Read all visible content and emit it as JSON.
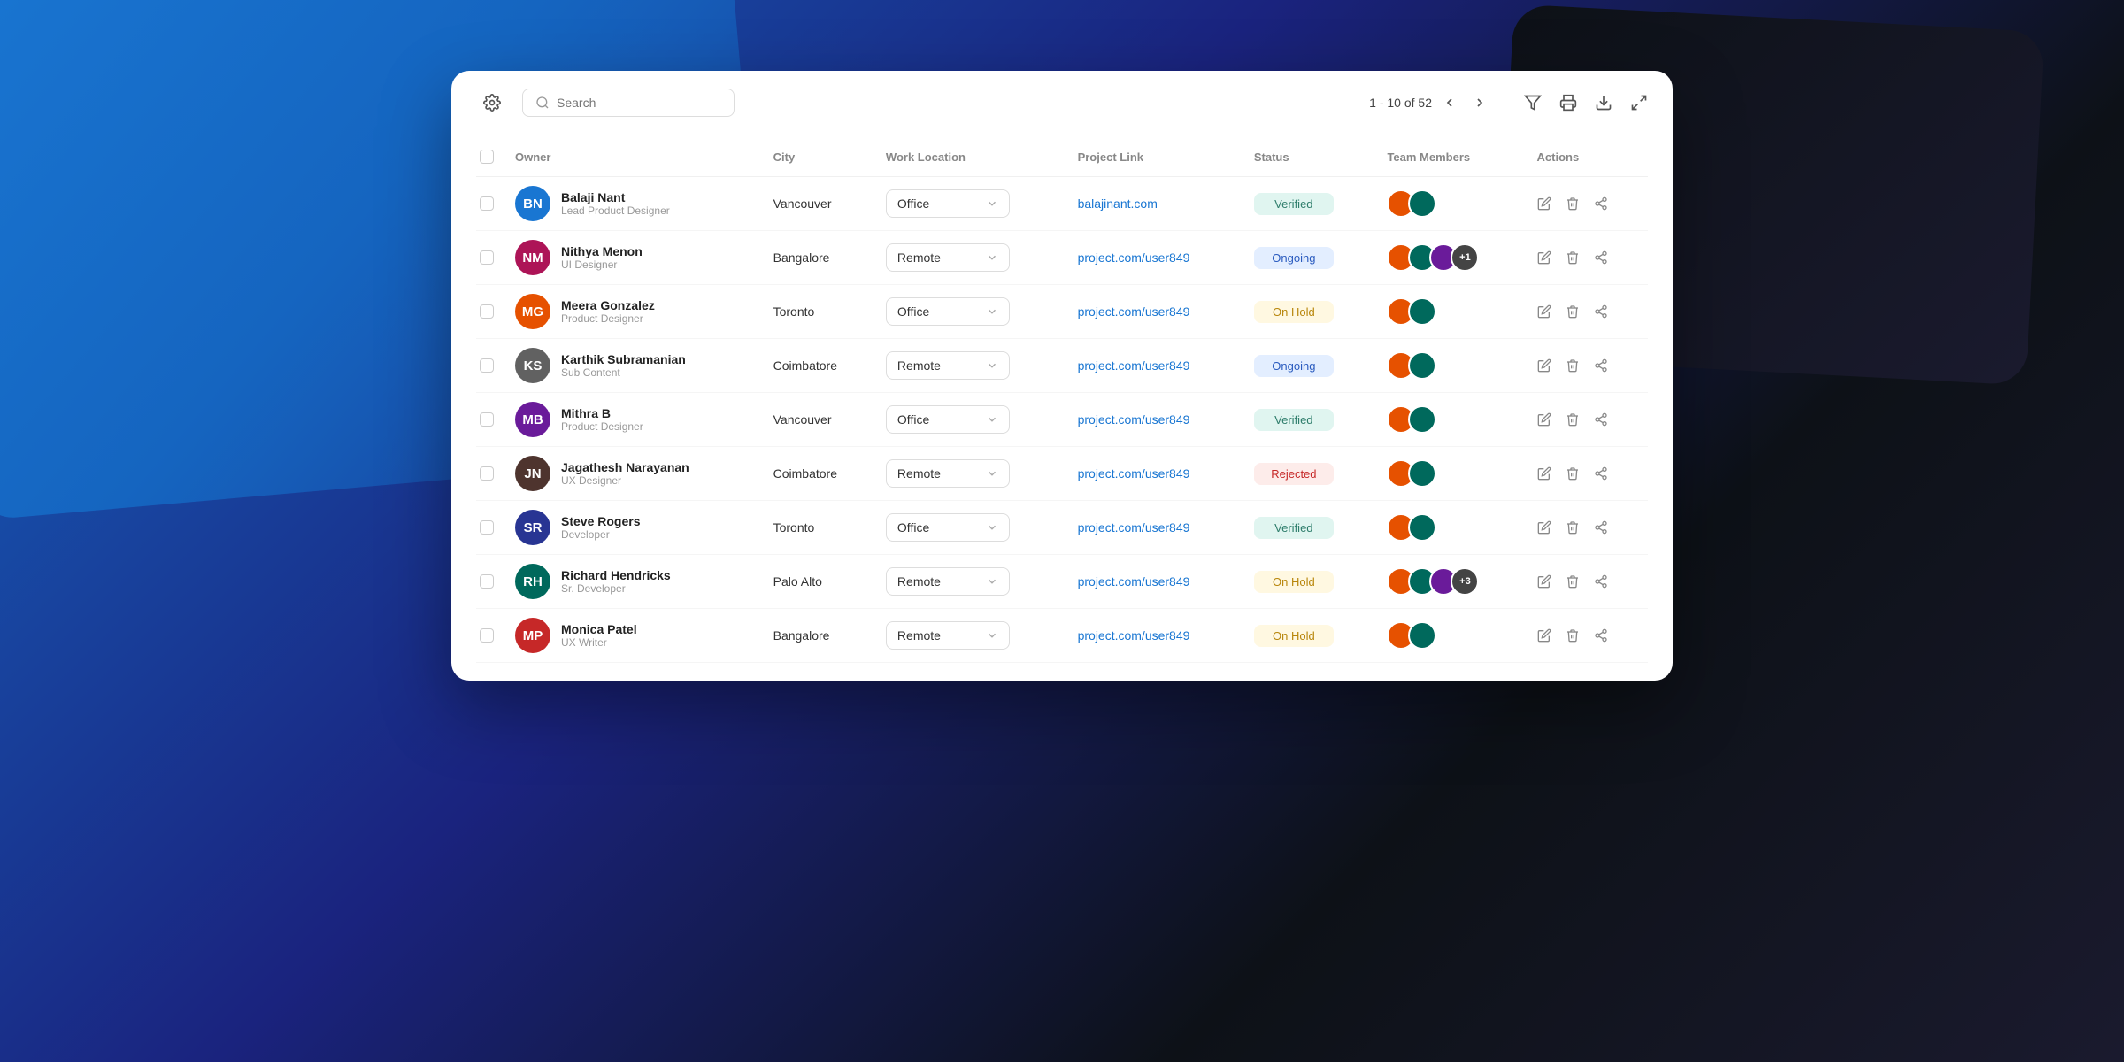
{
  "toolbar": {
    "search_placeholder": "Search",
    "pagination": "1 - 10  of 52",
    "gear_label": "Settings"
  },
  "table": {
    "columns": [
      "",
      "Owner",
      "City",
      "Work Location",
      "Project Link",
      "Status",
      "Team Members",
      "Actions"
    ],
    "rows": [
      {
        "id": 1,
        "name": "Balaji Nant",
        "role": "Lead Product Designer",
        "city": "Vancouver",
        "work_location": "Office",
        "project_link": "balajinant.com",
        "status": "Verified",
        "team_count": null,
        "avatar_color": "av-blue",
        "avatar_initials": "BN"
      },
      {
        "id": 2,
        "name": "Nithya Menon",
        "role": "UI Designer",
        "city": "Bangalore",
        "work_location": "Remote",
        "project_link": "project.com/user849",
        "status": "Ongoing",
        "team_count": "+1",
        "avatar_color": "av-pink",
        "avatar_initials": "NM"
      },
      {
        "id": 3,
        "name": "Meera Gonzalez",
        "role": "Product Designer",
        "city": "Toronto",
        "work_location": "Office",
        "project_link": "project.com/user849",
        "status": "On Hold",
        "team_count": null,
        "avatar_color": "av-orange",
        "avatar_initials": "MG"
      },
      {
        "id": 4,
        "name": "Karthik Subramanian",
        "role": "Sub Content",
        "city": "Coimbatore",
        "work_location": "Remote",
        "project_link": "project.com/user849",
        "status": "Ongoing",
        "team_count": null,
        "avatar_color": "av-gray",
        "avatar_initials": "KS"
      },
      {
        "id": 5,
        "name": "Mithra B",
        "role": "Product Designer",
        "city": "Vancouver",
        "work_location": "Office",
        "project_link": "project.com/user849",
        "status": "Verified",
        "team_count": null,
        "avatar_color": "av-purple",
        "avatar_initials": "MB"
      },
      {
        "id": 6,
        "name": "Jagathesh Narayanan",
        "role": "UX Designer",
        "city": "Coimbatore",
        "work_location": "Remote",
        "project_link": "project.com/user849",
        "status": "Rejected",
        "team_count": null,
        "avatar_color": "av-brown",
        "avatar_initials": "JN"
      },
      {
        "id": 7,
        "name": "Steve Rogers",
        "role": "Developer",
        "city": "Toronto",
        "work_location": "Office",
        "project_link": "project.com/user849",
        "status": "Verified",
        "team_count": null,
        "avatar_color": "av-indigo",
        "avatar_initials": "SR"
      },
      {
        "id": 8,
        "name": "Richard Hendricks",
        "role": "Sr. Developer",
        "city": "Palo Alto",
        "work_location": "Remote",
        "project_link": "project.com/user849",
        "status": "On Hold",
        "team_count": "+3",
        "avatar_color": "av-teal",
        "avatar_initials": "RH"
      },
      {
        "id": 9,
        "name": "Monica Patel",
        "role": "UX Writer",
        "city": "Bangalore",
        "work_location": "Remote",
        "project_link": "project.com/user849",
        "status": "On Hold",
        "team_count": null,
        "avatar_color": "av-red",
        "avatar_initials": "MP"
      }
    ]
  }
}
